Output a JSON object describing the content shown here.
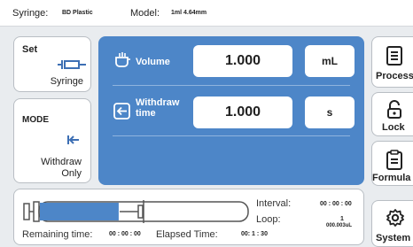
{
  "header": {
    "syringe_key": "Syringe:",
    "syringe_value": "BD Plastic",
    "model_key": "Model:",
    "model_value": "1ml 4.64mm"
  },
  "set_card": {
    "title": "Set",
    "value": "Syringe",
    "icon": "syringe-icon"
  },
  "mode_card": {
    "title": "MODE",
    "value_line1": "Withdraw",
    "value_line2": "Only",
    "icon": "withdraw-arrow-icon"
  },
  "panel": {
    "color": "#4d86c8",
    "volume": {
      "label": "Volume",
      "value": "1.000",
      "unit": "mL",
      "icon": "volume-icon"
    },
    "withdraw_time": {
      "label_line1": "Withdraw",
      "label_line2": "time",
      "value": "1.000",
      "unit": "s",
      "icon": "withdraw-time-icon"
    }
  },
  "sidebar": {
    "process": {
      "label": "Process",
      "icon": "process-icon"
    },
    "lock": {
      "label": "Lock",
      "icon": "lock-icon"
    },
    "formula": {
      "label": "Formula",
      "icon": "formula-icon"
    },
    "system": {
      "label": "System",
      "icon": "gear-icon"
    }
  },
  "status": {
    "fill_fraction": 0.38,
    "fill_color": "#4d86c8",
    "interval_label": "Interval:",
    "interval_value": "00 : 00 : 00",
    "loop_label": "Loop:",
    "loop_value": "1",
    "loop_sub": "000.003uL",
    "remaining_label": "Remaining time:",
    "remaining_value": "00 : 00 : 00",
    "elapsed_label": "Elapsed Time:",
    "elapsed_value": "00: 1 : 30"
  }
}
